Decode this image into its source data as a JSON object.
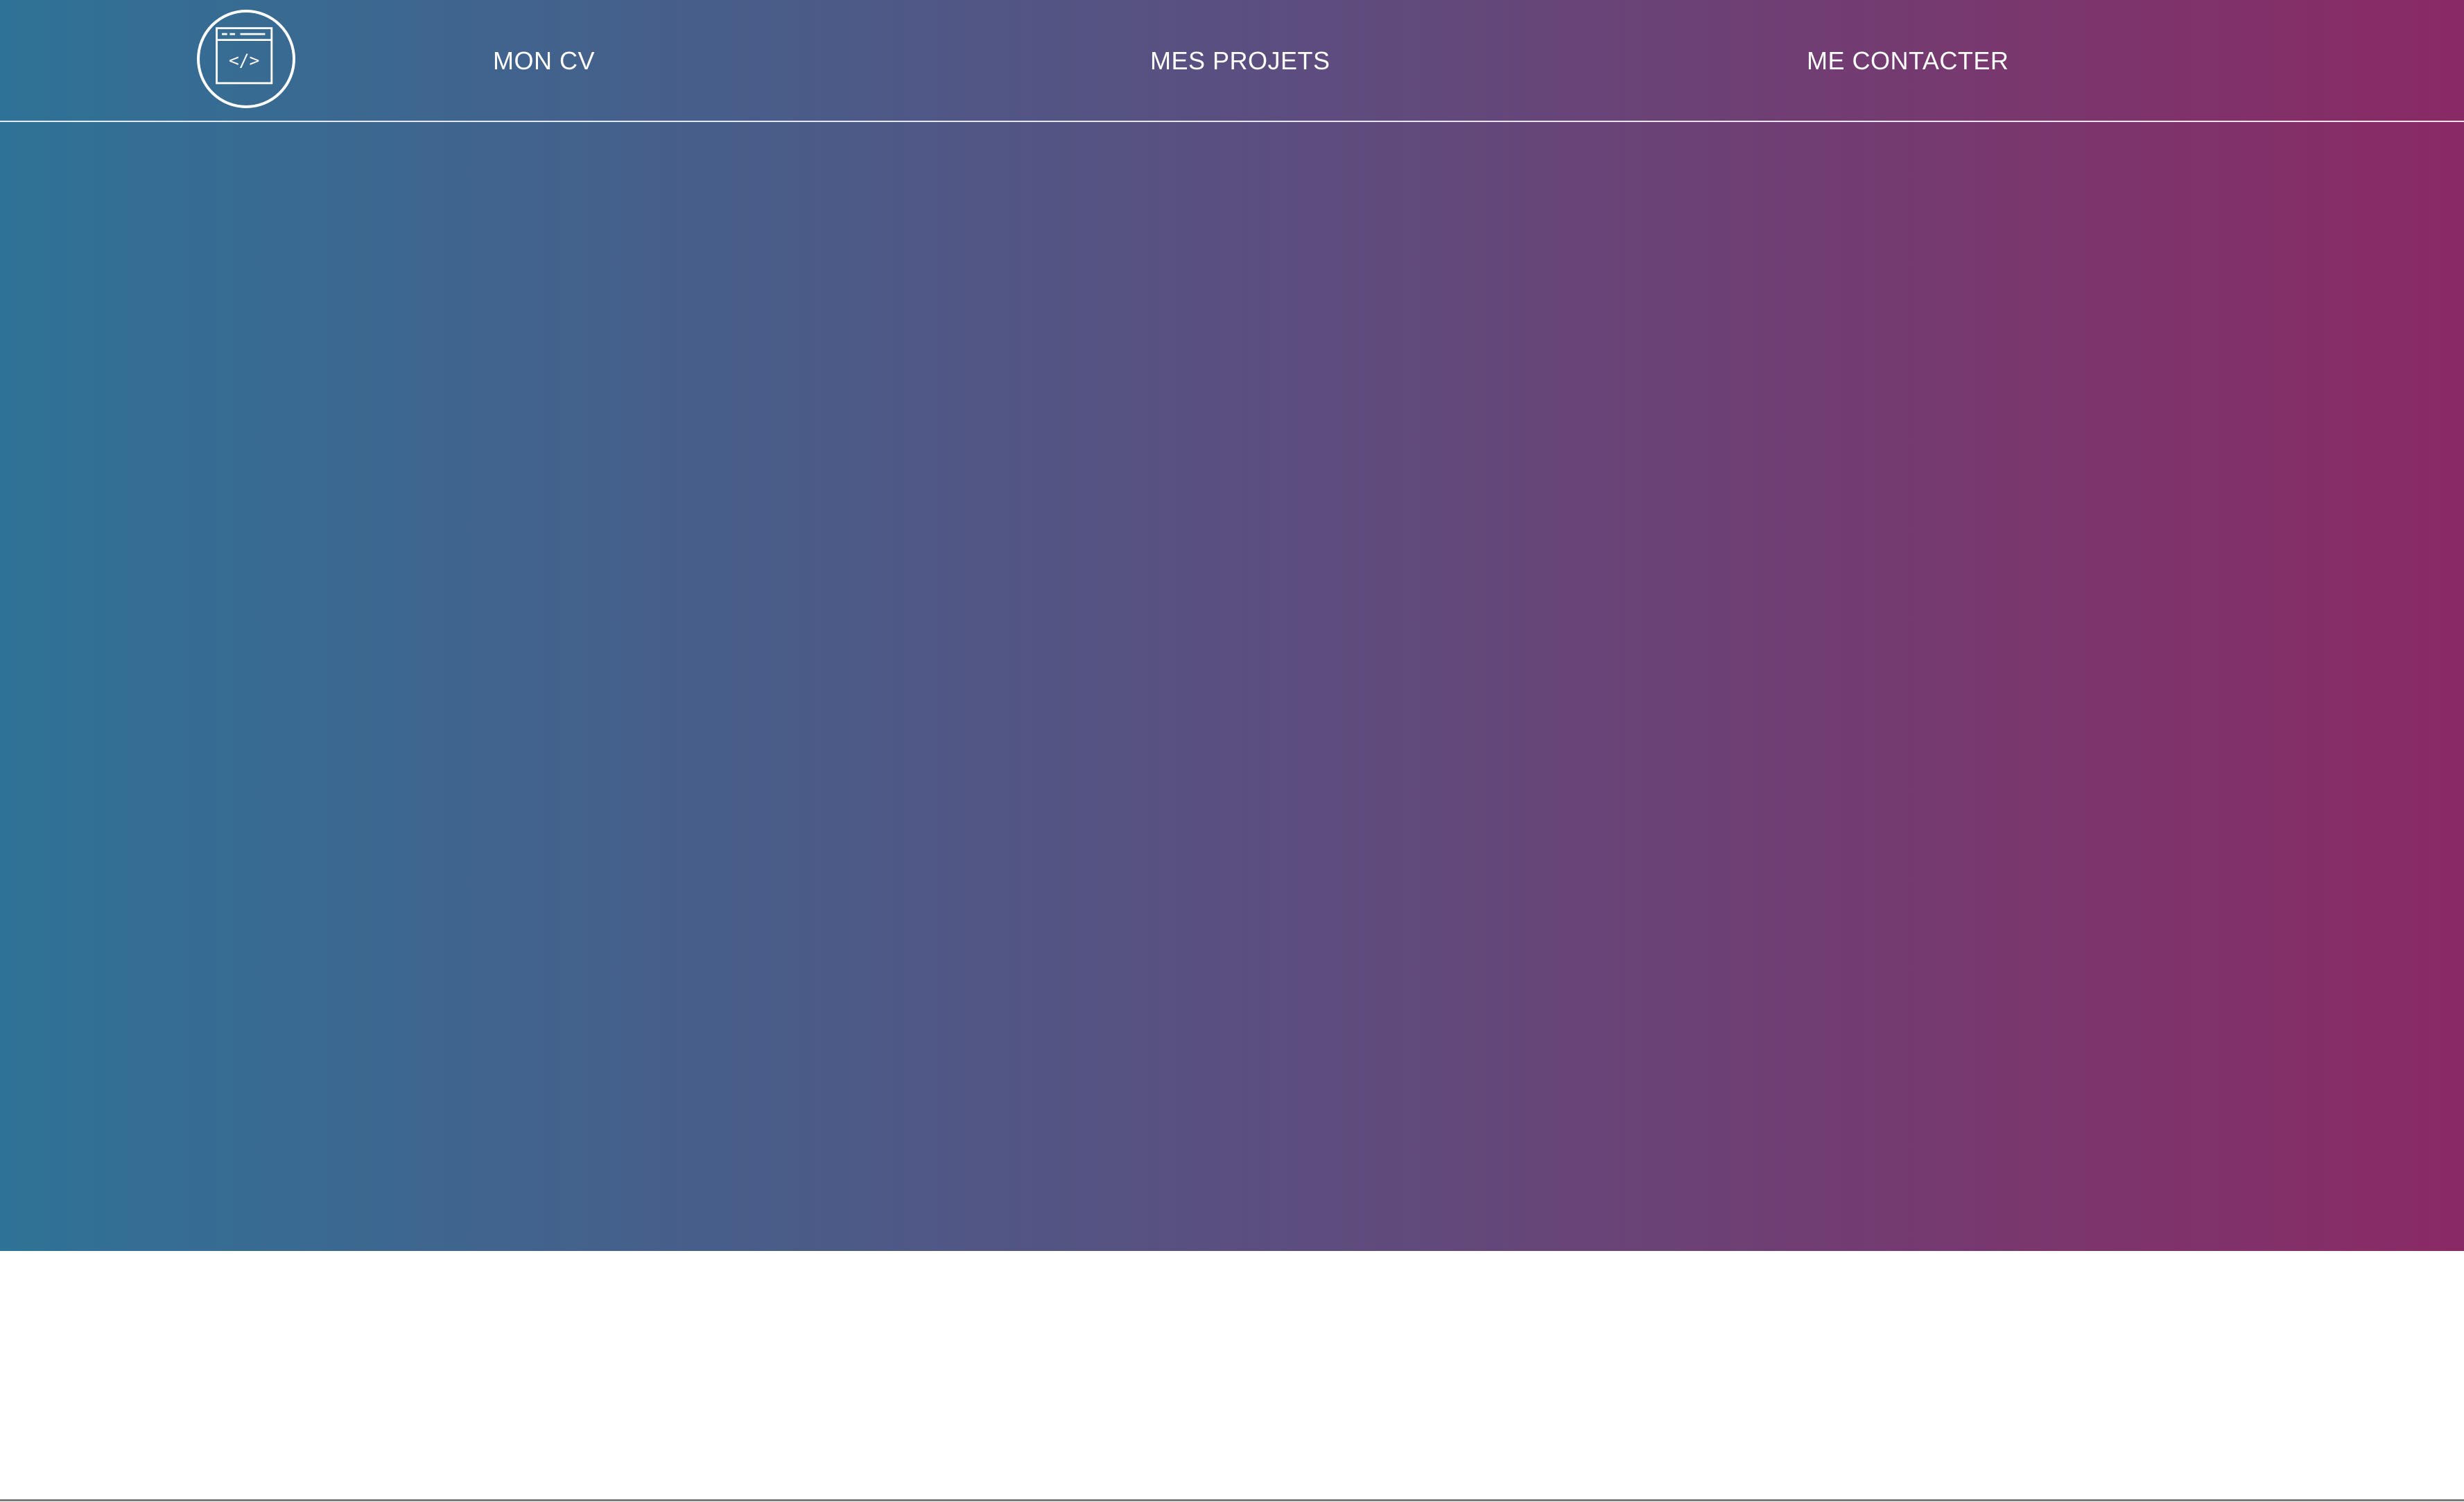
{
  "brand": {
    "logo_icon": "code-window-icon",
    "logo_glyph": "</>"
  },
  "nav": {
    "items": [
      {
        "label": "MON CV"
      },
      {
        "label": "MES PROJETS"
      },
      {
        "label": "ME CONTACTER"
      }
    ]
  },
  "colors": {
    "gradient_start": "#2f7297",
    "gradient_mid": "#5a4f80",
    "gradient_end": "#8a2a64",
    "nav_text": "#ffffff",
    "content_bg": "#ffffff"
  }
}
